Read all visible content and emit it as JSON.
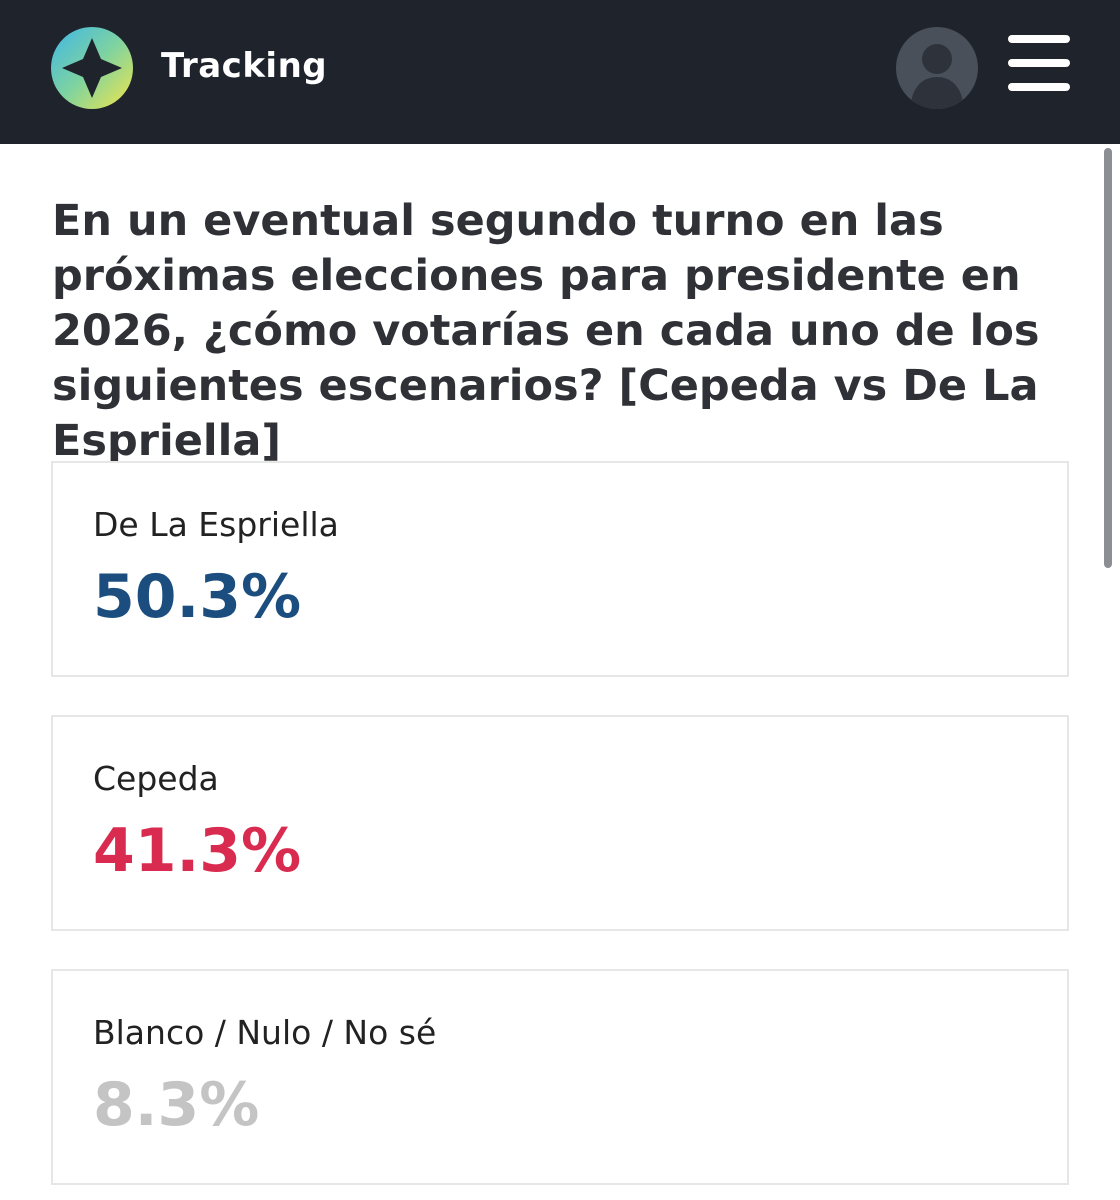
{
  "header": {
    "app_title": "Tracking",
    "logo_icon": "compass-star-icon",
    "avatar_icon": "user-silhouette-icon",
    "menu_icon": "hamburger-menu-icon"
  },
  "question": "En un eventual segundo turno en las próximas elecciones para presidente en 2026, ¿cómo votarías en cada uno de los siguientes escenarios? [Cepeda vs De La Espriella]",
  "results": [
    {
      "label": "De La Espriella",
      "value": "50.3%",
      "color": "#1b4e7e"
    },
    {
      "label": "Cepeda",
      "value": "41.3%",
      "color": "#d92b4f"
    },
    {
      "label": "Blanco / Nulo / No sé",
      "value": "8.3%",
      "color": "#c4c4c4"
    }
  ],
  "colors": {
    "header_bg": "#1f242c",
    "text_dark": "#2f3136",
    "card_border": "#e6e6e6"
  }
}
